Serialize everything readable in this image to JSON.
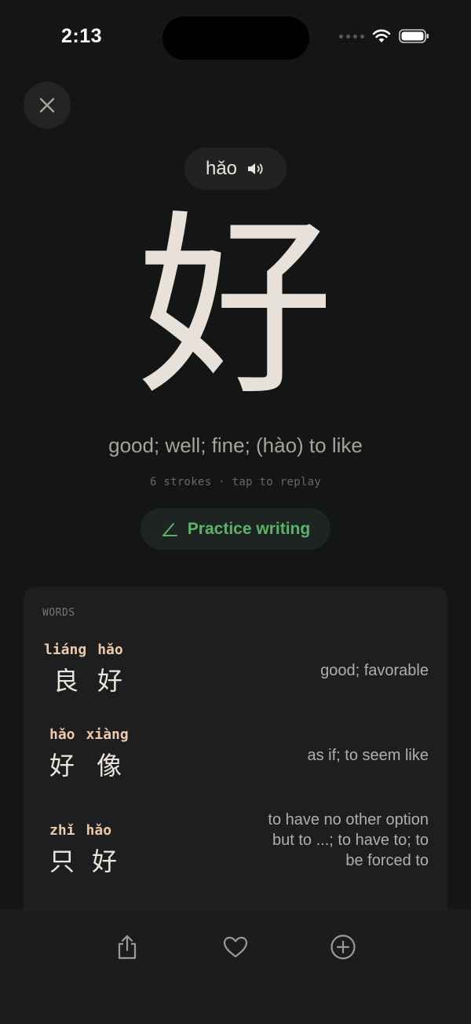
{
  "status": {
    "time": "2:13"
  },
  "character": {
    "pinyin": "hǎo",
    "hanzi": "好",
    "meaning": "good; well; fine; (hào) to like",
    "stroke_info": "6 strokes · tap to replay"
  },
  "practice": {
    "label": "Practice writing"
  },
  "words": {
    "header": "WORDS",
    "items": [
      {
        "pinyin": [
          "liáng",
          "hǎo"
        ],
        "chars": [
          "良",
          "好"
        ],
        "definition": "good; favorable"
      },
      {
        "pinyin": [
          "hǎo",
          "xiàng"
        ],
        "chars": [
          "好",
          "像"
        ],
        "definition": "as if; to seem like"
      },
      {
        "pinyin": [
          "zhǐ",
          "hǎo"
        ],
        "chars": [
          "只",
          "好"
        ],
        "definition": "to have no other option but to ...; to have to; to be forced to"
      }
    ]
  },
  "icons": {
    "close": "close-icon",
    "speaker": "speaker-icon",
    "pencil": "pencil-icon",
    "share": "share-icon",
    "favorite": "heart-icon",
    "add": "plus-circle-icon"
  },
  "colors": {
    "background": "#141515",
    "card": "#1c1e1f",
    "pinyin_accent": "#efc9a5",
    "practice_green": "#5bb36a"
  }
}
